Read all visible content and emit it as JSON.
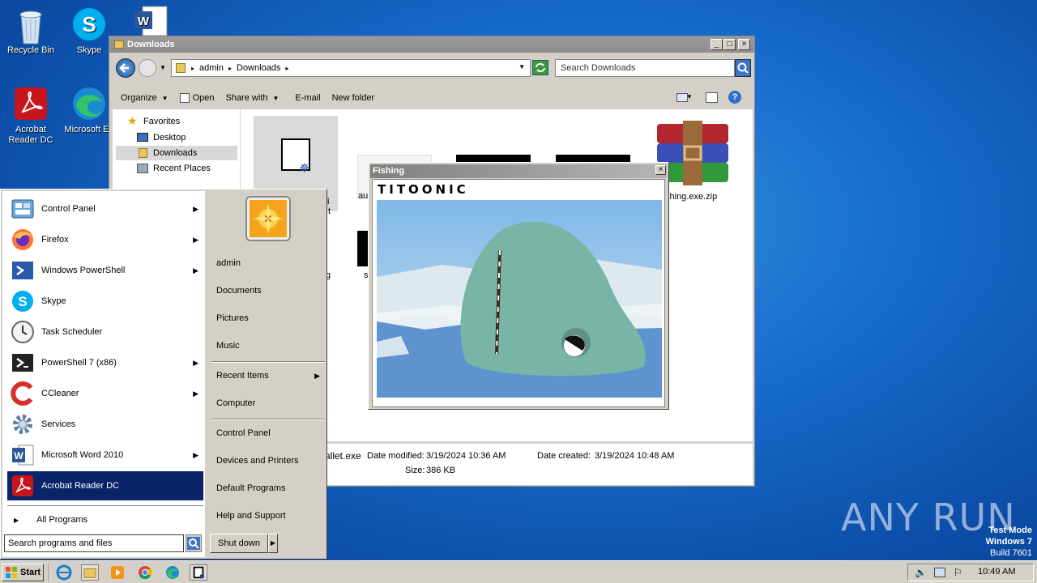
{
  "desktop": {
    "icons": [
      {
        "label": "Recycle Bin",
        "icon": "recycle-bin-icon"
      },
      {
        "label": "Skype",
        "icon": "skype-icon"
      },
      {
        "label": "Acrobat Reader DC",
        "icon": "acrobat-icon"
      },
      {
        "label": "Microsoft Ed",
        "icon": "edge-icon"
      },
      {
        "label": "",
        "icon": "word-document-icon"
      }
    ],
    "watermark": "ANY RUN",
    "test_mode": [
      "Test Mode",
      "Windows 7",
      "Build 7601"
    ]
  },
  "explorer": {
    "title": "Downloads",
    "breadcrumb": [
      "admin",
      "Downloads"
    ],
    "search_placeholder": "Search Downloads",
    "toolbar": {
      "organize": "Organize",
      "open": "Open",
      "share_with": "Share with",
      "email": "E-mail",
      "new_folder": "New folder"
    },
    "nav": {
      "favorites": "Favorites",
      "items": [
        "Desktop",
        "Downloads",
        "Recent Places"
      ]
    },
    "files": [
      {
        "name": "fi",
        "sub": "t"
      },
      {
        "name": "au"
      },
      {
        "name": ""
      },
      {
        "name": ""
      },
      {
        "name": "shing.exe.zip"
      },
      {
        "name": "g"
      },
      {
        "name": "s"
      }
    ],
    "status": {
      "filename": "allet.exe",
      "date_modified_label": "Date modified:",
      "date_modified": "3/19/2024 10:36 AM",
      "date_created_label": "Date created:",
      "date_created": "3/19/2024 10:48 AM",
      "size_label": "Size:",
      "size": "386 KB"
    }
  },
  "fishing": {
    "title": "Fishing",
    "brand": "TITOONIC"
  },
  "start_menu": {
    "programs": [
      {
        "label": "Control Panel",
        "arrow": true
      },
      {
        "label": "Firefox",
        "arrow": true
      },
      {
        "label": "Windows PowerShell",
        "arrow": true
      },
      {
        "label": "Skype",
        "arrow": false
      },
      {
        "label": "Task Scheduler",
        "arrow": false
      },
      {
        "label": "PowerShell 7 (x86)",
        "arrow": true
      },
      {
        "label": "CCleaner",
        "arrow": true
      },
      {
        "label": "Services",
        "arrow": false
      },
      {
        "label": "Microsoft Word 2010",
        "arrow": true
      },
      {
        "label": "Acrobat Reader DC",
        "arrow": false
      }
    ],
    "all_programs": "All Programs",
    "search_placeholder": "Search programs and files",
    "right": [
      "admin",
      "Documents",
      "Pictures",
      "Music",
      "Recent Items",
      "Computer",
      "Control Panel",
      "Devices and Printers",
      "Default Programs",
      "Help and Support"
    ],
    "shutdown": "Shut down"
  },
  "taskbar": {
    "start": "Start",
    "clock": "10:49 AM"
  }
}
